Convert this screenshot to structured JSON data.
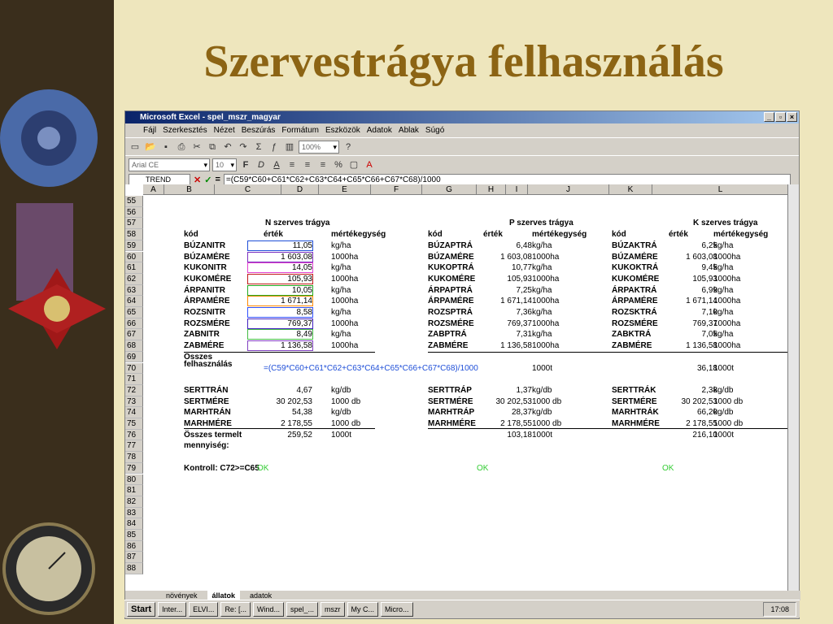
{
  "slide_title": "Szervestrágya felhasználás",
  "window": {
    "title": "Microsoft Excel - spel_mszr_magyar"
  },
  "menu": [
    "Fájl",
    "Szerkesztés",
    "Nézet",
    "Beszúrás",
    "Formátum",
    "Eszközök",
    "Adatok",
    "Ablak",
    "Súgó"
  ],
  "toolbar": {
    "zoom": "100%",
    "font": "Arial CE",
    "size": "10"
  },
  "formula": {
    "name_box": "TREND",
    "content": "=(C59*C60+C61*C62+C63*C64+C65*C66+C67*C68)/1000"
  },
  "columns": [
    "A",
    "B",
    "C",
    "D",
    "E",
    "F",
    "G",
    "H",
    "I",
    "J",
    "K",
    "L"
  ],
  "rows": [
    "55",
    "56",
    "57",
    "58",
    "59",
    "60",
    "61",
    "62",
    "63",
    "64",
    "65",
    "66",
    "67",
    "68",
    "69",
    "70",
    "71",
    "72",
    "73",
    "74",
    "75",
    "76",
    "77",
    "78",
    "79",
    "80",
    "81",
    "82",
    "83",
    "84",
    "85",
    "86",
    "87",
    "88"
  ],
  "sections": [
    {
      "title": "N szerves trágya",
      "rows": [
        [
          "BÚZANITR",
          "11,05",
          "kg/ha"
        ],
        [
          "BÚZAMÉRE",
          "1 603,08",
          "1000ha"
        ],
        [
          "KUKONITR",
          "14,05",
          "kg/ha"
        ],
        [
          "KUKOMÉRE",
          "105,93",
          "1000ha"
        ],
        [
          "ÁRPANITR",
          "10,05",
          "kg/ha"
        ],
        [
          "ÁRPAMÉRE",
          "1 671,14",
          "1000ha"
        ],
        [
          "ROZSNITR",
          "8,58",
          "kg/ha"
        ],
        [
          "ROZSMÉRE",
          "769,37",
          "1000ha"
        ],
        [
          "ZABNITR",
          "8,49",
          "kg/ha"
        ],
        [
          "ZABMÉRE",
          "1 136,58",
          "1000ha"
        ]
      ],
      "total": "=(C59*C60+C61*C62+C63*C64+C65*C66+C67*C68)/1000",
      "total_unit": "",
      "bottom": [
        [
          "SERTTRÁN",
          "4,67",
          "kg/db"
        ],
        [
          "SERTMÉRE",
          "30 202,53",
          "1000 db"
        ],
        [
          "MARHTRÁN",
          "54,38",
          "kg/db"
        ],
        [
          "MARHMÉRE",
          "2 178,55",
          "1000 db"
        ]
      ],
      "produced": "259,52",
      "produced_unit": "1000t",
      "check": "OK"
    },
    {
      "title": "P szerves trágya",
      "rows": [
        [
          "BÚZAPTRÁ",
          "6,48",
          "kg/ha"
        ],
        [
          "BÚZAMÉRE",
          "1 603,08",
          "1000ha"
        ],
        [
          "KUKOPTRÁ",
          "10,77",
          "kg/ha"
        ],
        [
          "KUKOMÉRE",
          "105,93",
          "1000ha"
        ],
        [
          "ÁRPAPTRÁ",
          "7,25",
          "kg/ha"
        ],
        [
          "ÁRPAMÉRE",
          "1 671,14",
          "1000ha"
        ],
        [
          "ROZSPTRÁ",
          "7,36",
          "kg/ha"
        ],
        [
          "ROZSMÉRE",
          "769,37",
          "1000ha"
        ],
        [
          "ZABPTRÁ",
          "7,31",
          "kg/ha"
        ],
        [
          "ZABMÉRE",
          "1 136,58",
          "1000ha"
        ]
      ],
      "total": "",
      "total_unit": "1000t",
      "bottom": [
        [
          "SERTTRÁP",
          "1,37",
          "kg/db"
        ],
        [
          "SERTMÉRE",
          "30 202,53",
          "1000 db"
        ],
        [
          "MARHTRÁP",
          "28,37",
          "kg/db"
        ],
        [
          "MARHMÉRE",
          "2 178,55",
          "1000 db"
        ]
      ],
      "produced": "103,18",
      "produced_unit": "1000t",
      "check": "OK"
    },
    {
      "title": "K szerves trágya",
      "rows": [
        [
          "BÚZAKTRÁ",
          "6,25",
          "kg/ha"
        ],
        [
          "BÚZAMÉRE",
          "1 603,08",
          "1000ha"
        ],
        [
          "KUKOKTRÁ",
          "9,45",
          "kg/ha"
        ],
        [
          "KUKOMÉRE",
          "105,93",
          "1000ha"
        ],
        [
          "ÁRPAKTRÁ",
          "6,99",
          "kg/ha"
        ],
        [
          "ÁRPAMÉRE",
          "1 671,14",
          "1000ha"
        ],
        [
          "ROZSKTRÁ",
          "7,10",
          "kg/ha"
        ],
        [
          "ROZSMÉRE",
          "769,37",
          "1000ha"
        ],
        [
          "ZABKTRÁ",
          "7,05",
          "kg/ha"
        ],
        [
          "ZABMÉRE",
          "1 136,58",
          "1000ha"
        ]
      ],
      "total": "36,18",
      "total_unit": "1000t",
      "bottom": [
        [
          "SERTTRÁK",
          "2,38",
          "kg/db"
        ],
        [
          "SERTMÉRE",
          "30 202,53",
          "1000 db"
        ],
        [
          "MARHTRÁK",
          "66,20",
          "kg/db"
        ],
        [
          "MARHMÉRE",
          "2 178,55",
          "1000 db"
        ]
      ],
      "produced": "216,10",
      "produced_unit": "1000t",
      "check": "OK"
    }
  ],
  "labels": {
    "kod": "kód",
    "ertek": "érték",
    "mertek": "mértékegység",
    "osszes": "Összes",
    "felhasznalas": "felhasználás",
    "osszes_termelt": "Összes termelt",
    "mennyiseg": "mennyiség:",
    "kontroll": "Kontroll: C72>=C65"
  },
  "sheet_tabs": [
    "növények",
    "állatok",
    "adatok"
  ],
  "taskbar": {
    "start": "Start",
    "items": [
      "Inter...",
      "ELVI...",
      "Re: [...",
      "Wind...",
      "spel_...",
      "mszr",
      "My C...",
      "Micro..."
    ],
    "clock": "17:08"
  }
}
